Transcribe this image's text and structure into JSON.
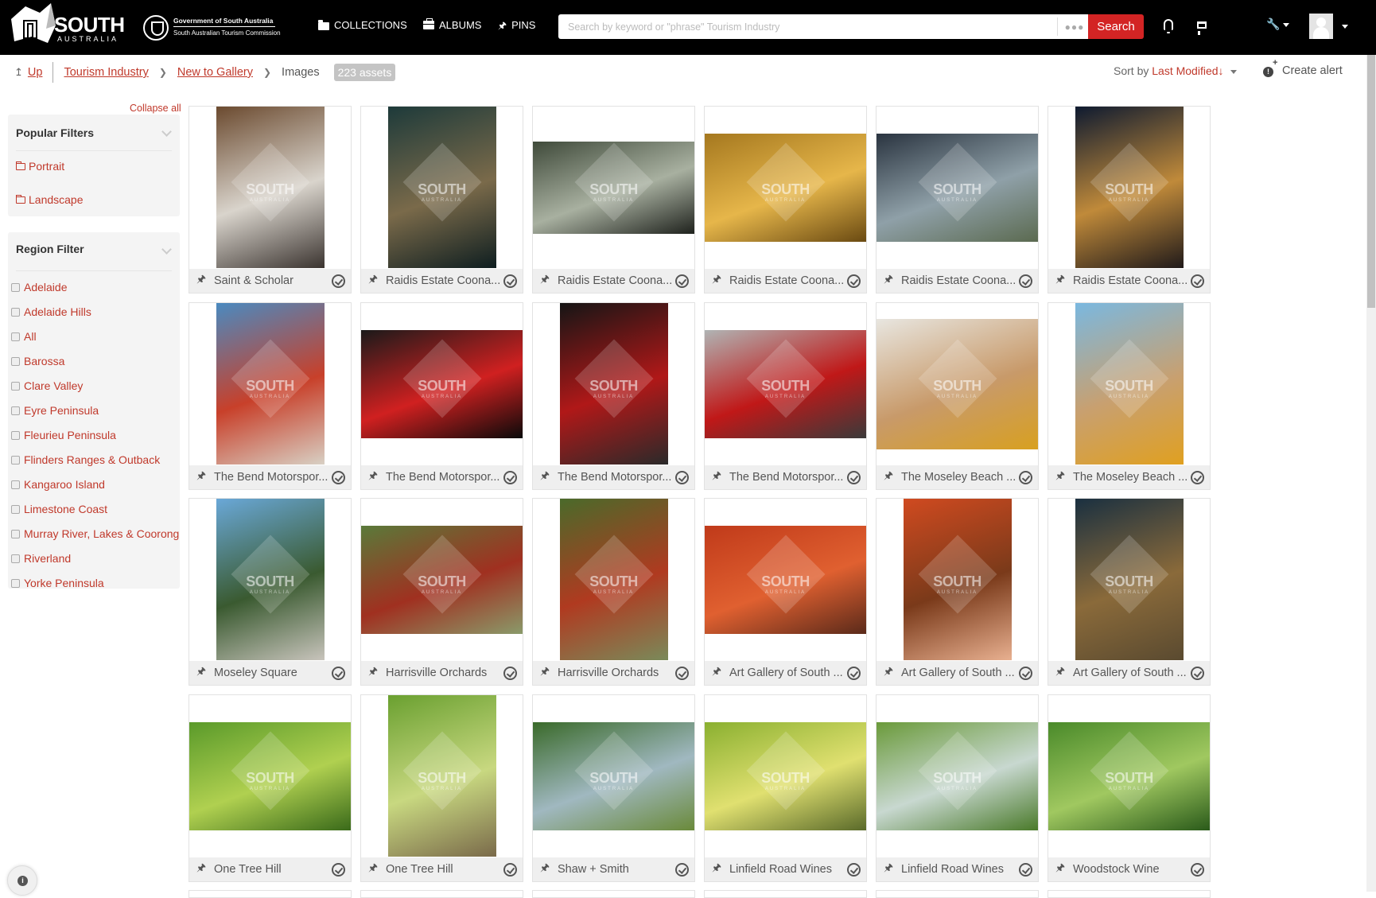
{
  "header": {
    "logo_text": "SOUTH",
    "logo_subtext": "AUSTRALIA",
    "gov_line1": "Government of South Australia",
    "gov_line2": "South Australian Tourism Commission",
    "nav": [
      {
        "label": "COLLECTIONS",
        "icon": "folder-icon"
      },
      {
        "label": "ALBUMS",
        "icon": "briefcase-icon"
      },
      {
        "label": "PINS",
        "icon": "pin-icon"
      }
    ],
    "search_placeholder": "Search by keyword or \"phrase\" Tourism Industry",
    "search_value": "",
    "search_more": "●●●",
    "search_button": "Search",
    "tools_icon": "✎"
  },
  "breadcrumb": {
    "up": "Up",
    "items": [
      "Tourism Industry",
      "New to Gallery"
    ],
    "current": "Images",
    "asset_count": "223 assets"
  },
  "sort": {
    "label": "Sort by",
    "value": "Last Modified",
    "direction": "↓"
  },
  "create_alert": "Create alert",
  "sidebar": {
    "collapse_all": "Collapse all",
    "popular_filters": {
      "title": "Popular Filters",
      "items": [
        "Portrait",
        "Landscape"
      ]
    },
    "region_filter": {
      "title": "Region Filter",
      "items": [
        {
          "label": "Adelaide",
          "checked": false
        },
        {
          "label": "Adelaide Hills",
          "checked": false
        },
        {
          "label": "All",
          "checked": false
        },
        {
          "label": "Barossa",
          "checked": false
        },
        {
          "label": "Clare Valley",
          "checked": false
        },
        {
          "label": "Eyre Peninsula",
          "checked": false
        },
        {
          "label": "Fleurieu Peninsula",
          "checked": false
        },
        {
          "label": "Flinders Ranges & Outback",
          "checked": false
        },
        {
          "label": "Kangaroo Island",
          "checked": false
        },
        {
          "label": "Limestone Coast",
          "checked": false
        },
        {
          "label": "Murray River, Lakes & Coorong",
          "checked": false
        },
        {
          "label": "Riverland",
          "checked": false
        },
        {
          "label": "Yorke Peninsula",
          "checked": false
        }
      ]
    }
  },
  "assets": [
    {
      "title": "Saint & Scholar",
      "orientation": "portrait",
      "colors": [
        "#6b4a2f",
        "#d9d4cc",
        "#3b3430"
      ]
    },
    {
      "title": "Raidis Estate Coona...",
      "orientation": "portrait",
      "colors": [
        "#1d3a3a",
        "#7a6a4a",
        "#0e1e20"
      ]
    },
    {
      "title": "Raidis Estate Coona...",
      "orientation": "landscape-short",
      "colors": [
        "#3f4a3a",
        "#a8b0a0",
        "#1f221d"
      ]
    },
    {
      "title": "Raidis Estate Coona...",
      "orientation": "landscape",
      "colors": [
        "#a5781f",
        "#e6b64a",
        "#6a4a12"
      ]
    },
    {
      "title": "Raidis Estate Coona...",
      "orientation": "landscape",
      "colors": [
        "#2a3440",
        "#8fa0a8",
        "#5b6a50"
      ]
    },
    {
      "title": "Raidis Estate Coona...",
      "orientation": "portrait",
      "colors": [
        "#0e1a30",
        "#c08a3a",
        "#201a1a"
      ]
    },
    {
      "title": "The Bend Motorspor...",
      "orientation": "portrait",
      "colors": [
        "#4a8ac0",
        "#c8402a",
        "#d8d0c4"
      ]
    },
    {
      "title": "The Bend Motorspor...",
      "orientation": "landscape",
      "colors": [
        "#1a1a1a",
        "#d02020",
        "#0a0a0a"
      ]
    },
    {
      "title": "The Bend Motorspor...",
      "orientation": "portrait",
      "colors": [
        "#151515",
        "#b01818",
        "#2a2a2a"
      ]
    },
    {
      "title": "The Bend Motorspor...",
      "orientation": "landscape",
      "colors": [
        "#b0b4b4",
        "#c01818",
        "#3a3a3a"
      ]
    },
    {
      "title": "The Moseley Beach ...",
      "orientation": "landscape-tall",
      "colors": [
        "#e8e6e0",
        "#c89a6a",
        "#d8a020"
      ]
    },
    {
      "title": "The Moseley Beach ...",
      "orientation": "portrait",
      "colors": [
        "#7ab8e0",
        "#c8a070",
        "#e0a020"
      ]
    },
    {
      "title": "Moseley Square",
      "orientation": "portrait",
      "colors": [
        "#6aa8d8",
        "#3a5a30",
        "#c8c4bc"
      ]
    },
    {
      "title": "Harrisville Orchards",
      "orientation": "landscape",
      "colors": [
        "#5a7a3a",
        "#a03020",
        "#8a9a6a"
      ]
    },
    {
      "title": "Harrisville Orchards",
      "orientation": "portrait",
      "colors": [
        "#4a6a2a",
        "#b03a20",
        "#7a8a5a"
      ]
    },
    {
      "title": "Art Gallery of South ...",
      "orientation": "landscape",
      "colors": [
        "#c03a1a",
        "#e06030",
        "#5a2a1a"
      ]
    },
    {
      "title": "Art Gallery of South ...",
      "orientation": "portrait",
      "colors": [
        "#d04a20",
        "#7a3a1a",
        "#e8b090"
      ]
    },
    {
      "title": "Art Gallery of South ...",
      "orientation": "portrait",
      "colors": [
        "#1a3040",
        "#8a6a3a",
        "#5a4a30"
      ]
    },
    {
      "title": "One Tree Hill",
      "orientation": "landscape",
      "colors": [
        "#5a9a2a",
        "#b0d050",
        "#3a6a1a"
      ]
    },
    {
      "title": "One Tree Hill",
      "orientation": "portrait",
      "colors": [
        "#6aa030",
        "#c8d880",
        "#7a6a4a"
      ]
    },
    {
      "title": "Shaw + Smith",
      "orientation": "landscape",
      "colors": [
        "#3a6a2a",
        "#a0b8c0",
        "#6a8a3a"
      ]
    },
    {
      "title": "Linfield Road Wines",
      "orientation": "landscape",
      "colors": [
        "#8ab030",
        "#e0e070",
        "#5a6a2a"
      ]
    },
    {
      "title": "Linfield Road Wines",
      "orientation": "landscape",
      "colors": [
        "#6a9a3a",
        "#c8d8d0",
        "#4a7a2a"
      ]
    },
    {
      "title": "Woodstock Wine",
      "orientation": "landscape",
      "colors": [
        "#4a8a2a",
        "#a0c860",
        "#2a5a1a"
      ]
    }
  ],
  "watermark": {
    "title": "SOUTH",
    "sub": "AUSTRALIA"
  },
  "info_button": "i"
}
